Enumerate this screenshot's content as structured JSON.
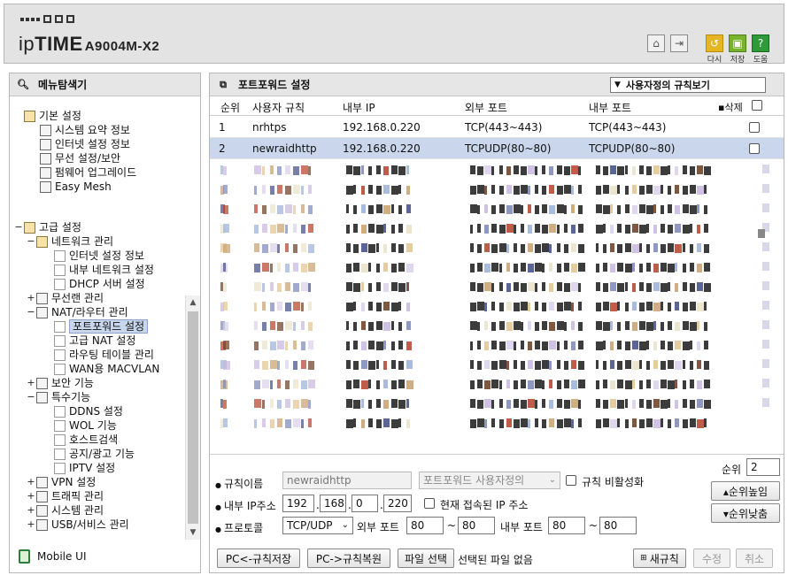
{
  "header": {
    "brand_light": "ip",
    "brand_bold": "TIME",
    "model": "A9004M-X2",
    "icons": [
      {
        "name": "home-icon",
        "label": ""
      },
      {
        "name": "logout-icon",
        "label": ""
      },
      {
        "name": "refresh-icon",
        "label": "다시"
      },
      {
        "name": "save-icon",
        "label": "저장"
      },
      {
        "name": "help-icon",
        "label": "도움"
      }
    ]
  },
  "menu": {
    "title": "메뉴탐색기",
    "basic": {
      "label": "기본 설정",
      "items": [
        "시스템 요약 정보",
        "인터넷 설정 정보",
        "무선 설정/보안",
        "펌웨어 업그레이드",
        "Easy Mesh"
      ]
    },
    "advanced": {
      "label": "고급 설정",
      "network": {
        "label": "네트워크 관리",
        "items": [
          "인터넷 설정 정보",
          "내부 네트워크 설정",
          "DHCP 서버 설정"
        ]
      },
      "wireless": "무선랜 관리",
      "nat": {
        "label": "NAT/라우터 관리",
        "items": [
          "포트포워드 설정",
          "고급 NAT 설정",
          "라우팅 테이블 관리",
          "WAN용 MACVLAN"
        ]
      },
      "security": "보안 기능",
      "special": {
        "label": "특수기능",
        "items": [
          "DDNS 설정",
          "WOL 기능",
          "호스트검색",
          "공지/광고 기능",
          "IPTV 설정"
        ]
      },
      "rest": [
        "VPN 설정",
        "트래픽 관리",
        "시스템 관리",
        "USB/서비스 관리"
      ]
    },
    "mobile_label": "Mobile UI"
  },
  "portforward": {
    "title": "포트포워드 설정",
    "view_select": "사용자정의 규칙보기",
    "columns": {
      "order": "순위",
      "rule": "사용자 규칙",
      "internal_ip": "내부 IP",
      "external_port": "외부 포트",
      "internal_port": "내부 포트",
      "delete": "삭제"
    },
    "rows": [
      {
        "order": "1",
        "rule": "nrhtps",
        "internal_ip": "192.168.0.220",
        "external_port": "TCP(443~443)",
        "internal_port": "TCP(443~443)",
        "selected": false
      },
      {
        "order": "2",
        "rule": "newraidhttp",
        "internal_ip": "192.168.0.220",
        "external_port": "TCPUDP(80~80)",
        "internal_port": "TCPUDP(80~80)",
        "selected": true
      }
    ],
    "blurred_row_count": 14
  },
  "form": {
    "rule_name_label": "규칙이름",
    "rule_name_value": "newraidhttp",
    "rule_type_value": "포트포워드 사용자정의",
    "disable_rule_label": "규칙 비활성화",
    "internal_ip_label": "내부 IP주소",
    "ip": [
      "192",
      "168",
      "0",
      "220"
    ],
    "current_ip_label": "현재 접속된 IP 주소",
    "protocol_label": "프로토콜",
    "protocol_value": "TCP/UDP",
    "external_port_label": "외부 포트",
    "external_port_from": "80",
    "external_port_to": "80",
    "internal_port_label": "내부 포트",
    "internal_port_from": "80",
    "internal_port_to": "80",
    "order_label": "순위",
    "order_value": "2",
    "order_up": "▴순위높임",
    "order_down": "▾순위낮춤",
    "tilde": "~",
    "ip_dot": "."
  },
  "buttons": {
    "backup": "PC<-규칙저장",
    "restore": "PC->규칙복원",
    "choose_file": "파일 선택",
    "no_file": "선택된 파일 없음",
    "new_rule": "새규칙",
    "modify": "수정",
    "cancel": "취소"
  }
}
